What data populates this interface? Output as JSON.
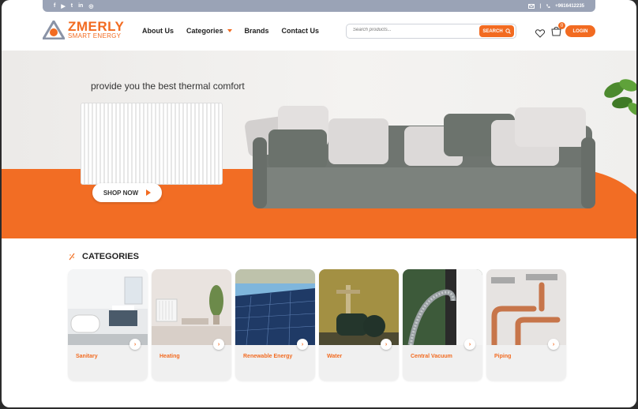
{
  "topbar": {
    "social": [
      "f",
      "▶",
      "t",
      "in",
      "◎"
    ],
    "phone": "+9616412235"
  },
  "logo": {
    "name": "ZMERLY",
    "tagline": "SMART ENERGY"
  },
  "nav": [
    "About Us",
    "Categories",
    "Brands",
    "Contact Us"
  ],
  "search": {
    "placeholder": "Search products...",
    "button": "SEARCH"
  },
  "cart": {
    "count": "0"
  },
  "login": "LOGIN",
  "hero": {
    "text": "provide you the best thermal comfort",
    "cta": "SHOP NOW"
  },
  "categories": {
    "title": "CATEGORIES",
    "items": [
      {
        "label": "Sanitary"
      },
      {
        "label": "Heating"
      },
      {
        "label": "Renewable Energy"
      },
      {
        "label": "Water"
      },
      {
        "label": "Central Vacuum"
      },
      {
        "label": "Piping"
      }
    ]
  },
  "colors": {
    "accent": "#f26b21",
    "topbar": "#9aa3b6"
  }
}
